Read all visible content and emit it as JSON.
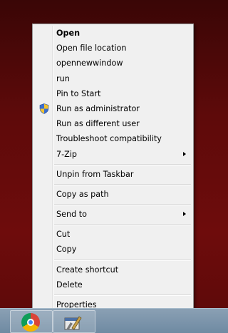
{
  "context_menu": {
    "items": [
      {
        "label": "Open"
      },
      {
        "label": "Open file location"
      },
      {
        "label": "opennewwindow"
      },
      {
        "label": "run"
      },
      {
        "label": "Pin to Start"
      },
      {
        "label": "Run as administrator",
        "icon": "uac-shield-icon"
      },
      {
        "label": "Run as different user"
      },
      {
        "label": "Troubleshoot compatibility"
      },
      {
        "label": "7-Zip"
      },
      {
        "label": "Unpin from Taskbar"
      },
      {
        "label": "Copy as path"
      },
      {
        "label": "Send to"
      },
      {
        "label": "Cut"
      },
      {
        "label": "Copy"
      },
      {
        "label": "Create shortcut"
      },
      {
        "label": "Delete"
      },
      {
        "label": "Properties"
      }
    ]
  },
  "taskbar": {
    "pinned": [
      {
        "icon": "chrome-icon"
      },
      {
        "icon": "application-icon"
      }
    ]
  },
  "colors": {
    "desktop_background": "#5e0a0a",
    "menu_background": "#f0f0f0",
    "taskbar": "#7c94aa"
  }
}
